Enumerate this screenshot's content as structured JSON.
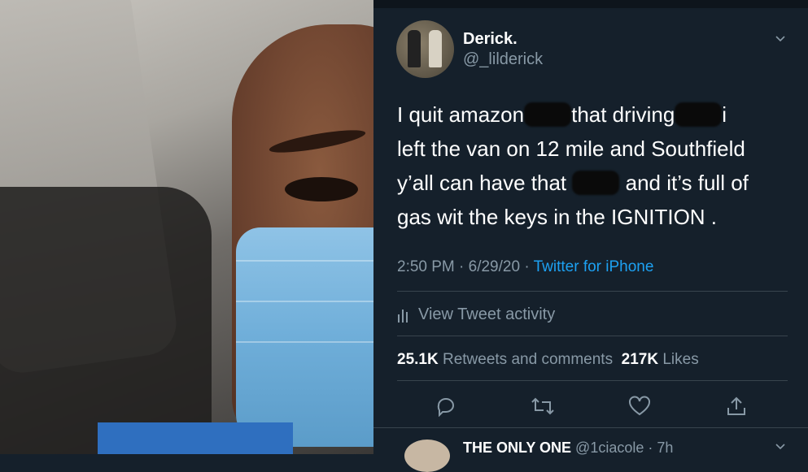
{
  "tweet": {
    "display_name": "Derick.",
    "handle": "@_lilderick",
    "text_lines": [
      "I quit amazon",
      "that driving",
      "i",
      "left the van on 12 mile and Southfield",
      "y’all can have that",
      "and it’s full of",
      "gas wit the keys in the IGNITION  ."
    ],
    "time": "2:50 PM · 6/29/20 ·",
    "source": "Twitter for iPhone",
    "activity_label": "View Tweet activity",
    "retweets_count": "25.1K",
    "retweets_label": "Retweets and comments",
    "likes_count": "217K",
    "likes_label": "Likes"
  },
  "reply": {
    "display_name": "THE ONLY ONE",
    "handle": "@1ciacole · 7h"
  },
  "icons": [
    "chevron-down-icon",
    "bar-chart-icon",
    "reply-icon",
    "retweet-icon",
    "like-icon",
    "share-icon"
  ],
  "colors": {
    "background": "#15202b",
    "link": "#1da1f2",
    "muted": "#8899a6",
    "divider": "#38444d"
  }
}
